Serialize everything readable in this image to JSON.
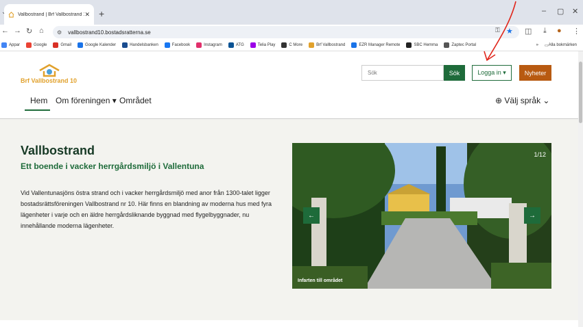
{
  "browser": {
    "tab_title": "Vallbostrand | Brf Vallbostrand 10",
    "tab_close": "✕",
    "new_tab": "+",
    "url": "vallbostrand10.bostadsratterna.se",
    "win_min": "–",
    "win_max": "▢",
    "win_close": "✕",
    "bookmarks": [
      {
        "label": "Appar",
        "color": "#4285f4"
      },
      {
        "label": "Google",
        "color": "#ea4335"
      },
      {
        "label": "Gmail",
        "color": "#d93025"
      },
      {
        "label": "Google Kalender",
        "color": "#1a73e8"
      },
      {
        "label": "Handelsbanken",
        "color": "#1a4c8f"
      },
      {
        "label": "Facebook",
        "color": "#1877f2"
      },
      {
        "label": "Instagram",
        "color": "#e1306c"
      },
      {
        "label": "ATG",
        "color": "#0b5394"
      },
      {
        "label": "Telia Play",
        "color": "#9b00e8"
      },
      {
        "label": "C More",
        "color": "#333333"
      },
      {
        "label": "Brf Vallbostrand",
        "color": "#e1a12c"
      },
      {
        "label": "EZR Manager Remote",
        "color": "#1a73e8"
      },
      {
        "label": "SBC Hemma",
        "color": "#222222"
      },
      {
        "label": "Zaptec Portal",
        "color": "#555555"
      }
    ],
    "bookmarks_overflow": "»",
    "all_bookmarks": "Alla bokmärken"
  },
  "header": {
    "logo_text": "Brf Vallbostrand 10",
    "search_placeholder": "Sök",
    "search_button": "Sök",
    "login_button": "Logga in ▾",
    "news_button": "Nyheter",
    "nav": [
      "Hem",
      "Om föreningen ▾",
      "Området"
    ],
    "language": "Välj språk ⌄"
  },
  "hero": {
    "title": "Vallbostrand",
    "subtitle": "Ett boende i vacker herrgårdsmiljö i Vallentuna",
    "body": "Vid Vallentunasjöns östra strand och i vacker herrgårdsmiljö med anor från 1300-talet ligger bostadsrättsföreningen Vallbostrand nr 10. Här finns en blandning av moderna hus med fyra lägenheter i varje och en äldre herrgårdsliknande byggnad med flygelbyggnader, nu innehållande moderna lägenheter.",
    "slide_counter": "1/12",
    "slide_caption": "Infarten till området",
    "prev": "←",
    "next": "→"
  },
  "colors": {
    "brand_green": "#1e6b3a",
    "logo_orange": "#e1a12c",
    "news_orange": "#b85a11",
    "annotation_red": "#e0261b"
  }
}
